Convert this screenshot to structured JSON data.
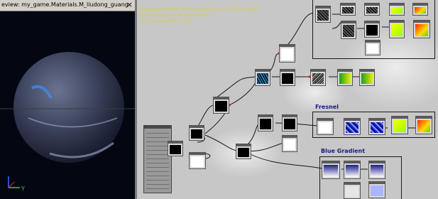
{
  "preview": {
    "title": "eview: my_game.Materials.M_liudong_guang",
    "close_glyph": "×",
    "axis_label": "Y"
  },
  "stats": {
    "lines": [
      "Base pass shader without light map: 42 instructions",
      "Vertex shader: 130 instructions",
      "Texture samplers: 3/16"
    ]
  },
  "groups": {
    "fresnel": "Fresnel",
    "blue_gradient": "Blue Gradient"
  },
  "colors": {
    "graph_bg": "#c7c7c7",
    "stats_text": "#d9d23a",
    "group_title": "#1c1c8a"
  }
}
